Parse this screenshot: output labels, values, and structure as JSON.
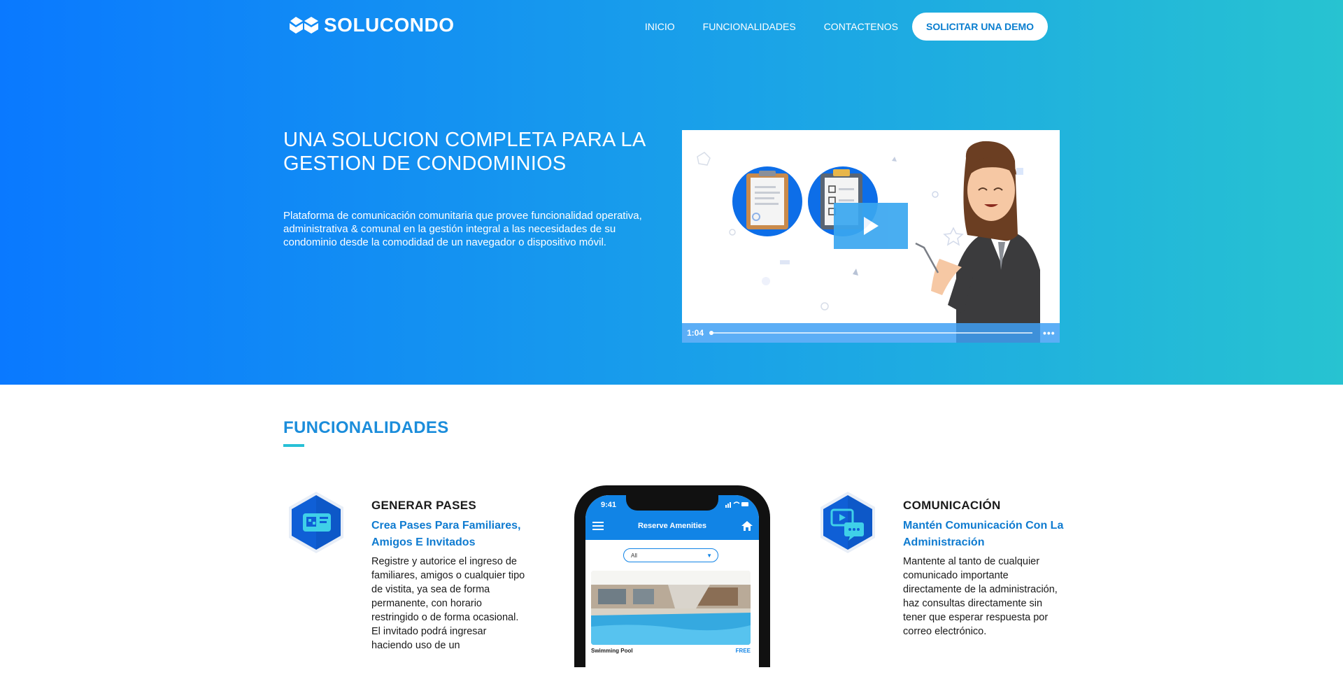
{
  "brand": {
    "logo_text": "SOLUCONDO"
  },
  "nav": {
    "links": [
      "INICIO",
      "FUNCIONALIDADES",
      "CONTACTENOS"
    ],
    "cta": "SOLICITAR UNA DEMO"
  },
  "hero": {
    "title": "UNA SOLUCION COMPLETA PARA LA GESTION DE CONDOMINIOS",
    "description": "Plataforma de comunicación comunitaria que provee funcionalidad operativa, administrativa & comunal en la gestión integral a las necesidades de su condominio desde la comodidad de un navegador o dispositivo móvil."
  },
  "video": {
    "duration": "1:04",
    "progress_fraction": 0.0,
    "icons": [
      "play-icon",
      "more-options-icon"
    ]
  },
  "features_section": {
    "title": "FUNCIONALIDADES"
  },
  "features": [
    {
      "title": "GENERAR PASES",
      "subtitle": "Crea Pases Para Familiares, Amigos E Invitados",
      "body": "Registre y autorice el ingreso de familiares, amigos o cualquier tipo de vistita, ya sea de forma permanente, con horario restringido o de forma ocasional. El invitado podrá ingresar haciendo uso de un",
      "icon": "ticket-pass-icon"
    },
    {
      "title": "COMUNICACIÓN",
      "subtitle": "Mantén Comunicación Con La Administración",
      "body": "Mantente al tanto de cualquier comunicado importante directamente de la administración, haz consultas directamente sin tener que esperar respuesta por correo electrónico.",
      "icon": "chat-bubbles-icon"
    }
  ],
  "phone": {
    "status_time": "9:41",
    "title": "Reserve Amenities",
    "filter_value": "All",
    "amenity_name": "Swimming Pool",
    "amenity_price": "FREE"
  },
  "colors": {
    "hero_start": "#0a79ff",
    "hero_end": "#27c3d1",
    "accent": "#1b8ddb",
    "link": "#0f7bd0"
  }
}
